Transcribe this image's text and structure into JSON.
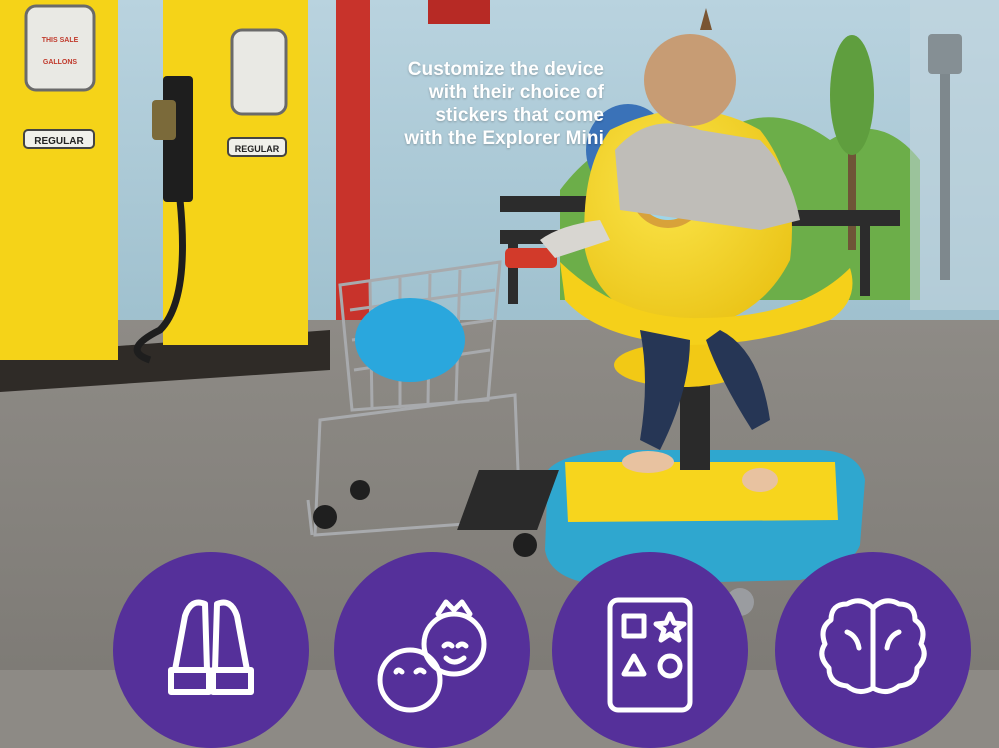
{
  "caption": {
    "lines": [
      "Customize the device",
      "with their choice of",
      "stickers that come",
      "with the Explorer Mini"
    ]
  },
  "pumps": {
    "label": "REGULAR",
    "readout_sale": "THIS SALE",
    "readout_gallons": "GALLONS"
  },
  "icons": [
    {
      "name": "binoculars-icon"
    },
    {
      "name": "children-faces-icon"
    },
    {
      "name": "shapes-board-icon"
    },
    {
      "name": "brain-icon"
    }
  ],
  "colors": {
    "badge": "#55309a",
    "pump_yellow": "#f5d318",
    "device_yellow": "#f7d51d",
    "device_base": "#2fa7cf",
    "wall": "#a8c8d6",
    "floor": "#8d8a85"
  }
}
